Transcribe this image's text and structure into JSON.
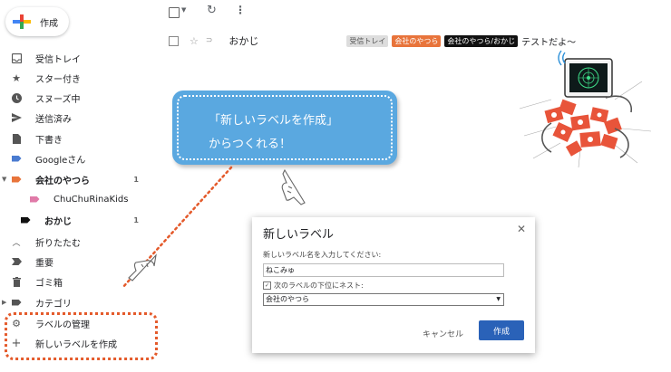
{
  "compose": {
    "label": "作成"
  },
  "sidebar": {
    "items": [
      {
        "label": "受信トレイ",
        "icon": "inbox-icon"
      },
      {
        "label": "スター付き",
        "icon": "star-icon"
      },
      {
        "label": "スヌーズ中",
        "icon": "clock-icon"
      },
      {
        "label": "送信済み",
        "icon": "send-icon"
      },
      {
        "label": "下書き",
        "icon": "draft-icon"
      },
      {
        "label": "Googleさん",
        "icon": "label-icon",
        "color": "#4a7bd0"
      },
      {
        "label": "会社のやつら",
        "icon": "label-icon",
        "color": "#e8743b",
        "count": "1"
      },
      {
        "label": "ChuChuRinaKids",
        "icon": "label-icon",
        "color": "#e07aa8"
      },
      {
        "label": "おかじ",
        "icon": "label-icon",
        "color": "#111111",
        "count": "1"
      },
      {
        "label": "折りたたむ",
        "icon": "chevron-up-icon"
      },
      {
        "label": "重要",
        "icon": "important-icon"
      },
      {
        "label": "ゴミ箱",
        "icon": "trash-icon"
      },
      {
        "label": "カテゴリ",
        "icon": "category-icon"
      },
      {
        "label": "ラベルの管理",
        "icon": "gear-icon"
      },
      {
        "label": "新しいラベルを作成",
        "icon": "plus-icon"
      }
    ]
  },
  "mail": {
    "sender": "おかじ",
    "chips": [
      {
        "label": "受信トレイ",
        "bg": "#dddddd",
        "fg": "#555555"
      },
      {
        "label": "会社のやつら",
        "bg": "#e8743b",
        "fg": "#ffffff"
      },
      {
        "label": "会社のやつら/おかじ",
        "bg": "#111111",
        "fg": "#ffffff"
      }
    ],
    "subject": "テストだよ〜"
  },
  "bubble": {
    "line1": "「新しいラベルを作成」",
    "line2": "からつくれる！"
  },
  "dialog": {
    "title": "新しいラベル",
    "name_label": "新しいラベル名を入力してください:",
    "name_value": "ねこみゅ",
    "nest_label": "次のラベルの下位にネスト:",
    "nest_value": "会社のやつら",
    "cancel": "キャンセル",
    "create": "作成"
  },
  "colors": {
    "accent": "#2a62b8",
    "bubble": "#5aa8e0",
    "highlight": "#e45a2b"
  }
}
